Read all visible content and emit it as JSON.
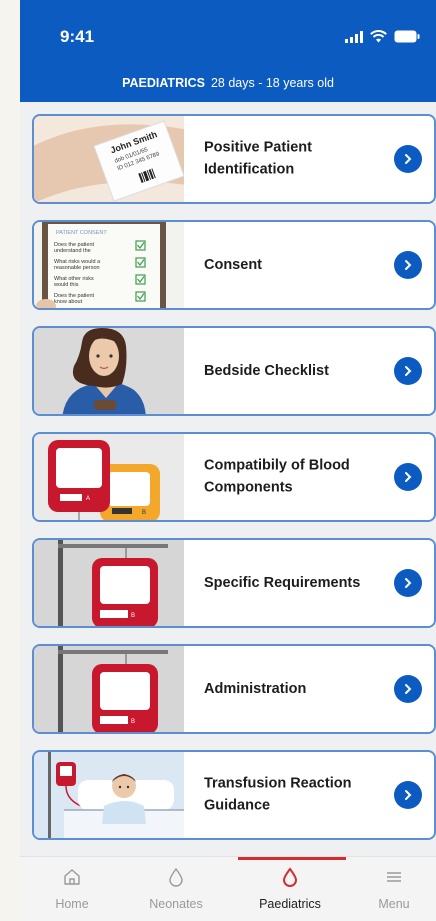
{
  "status": {
    "time": "9:41"
  },
  "header": {
    "section": "PAEDIATRICS",
    "range": "28 days - 18 years old"
  },
  "items": [
    {
      "title": "Positive Patient Identification",
      "icon": "wristband-thumbnail"
    },
    {
      "title": "Consent",
      "icon": "consent-form-thumbnail"
    },
    {
      "title": "Bedside Checklist",
      "icon": "nurse-thumbnail"
    },
    {
      "title": "Compatibily of Blood Components",
      "icon": "blood-bags-thumbnail"
    },
    {
      "title": "Specific Requirements",
      "icon": "blood-bag-thumbnail"
    },
    {
      "title": "Administration",
      "icon": "blood-bag-thumbnail"
    },
    {
      "title": "Transfusion Reaction Guidance",
      "icon": "child-in-bed-thumbnail"
    }
  ],
  "thumb_text": {
    "wristband_name": "John Smith",
    "wristband_dob": "dob 01/01/65",
    "wristband_id": "ID 012 345 6789",
    "consent_heading": "PATIENT CONSENT",
    "consent_q1a": "Does the patient",
    "consent_q1b": "understand the",
    "consent_q2a": "What risks would a",
    "consent_q2b": "reasonable person",
    "consent_q3a": "What other risks",
    "consent_q3b": "would this",
    "consent_q4a": "Does the patient",
    "consent_q4b": "know about",
    "bag_a": "A",
    "bag_b": "B"
  },
  "tabs": [
    {
      "label": "Home",
      "icon": "home-icon",
      "active": false
    },
    {
      "label": "Neonates",
      "icon": "drop-outline-icon",
      "active": false
    },
    {
      "label": "Paediatrics",
      "icon": "drop-outline-icon",
      "active": true
    },
    {
      "label": "Menu",
      "icon": "hamburger-icon",
      "active": false
    }
  ],
  "colors": {
    "primary": "#0c5bc0",
    "accent_red": "#d32e2e",
    "card_border": "#5c8fd1"
  }
}
